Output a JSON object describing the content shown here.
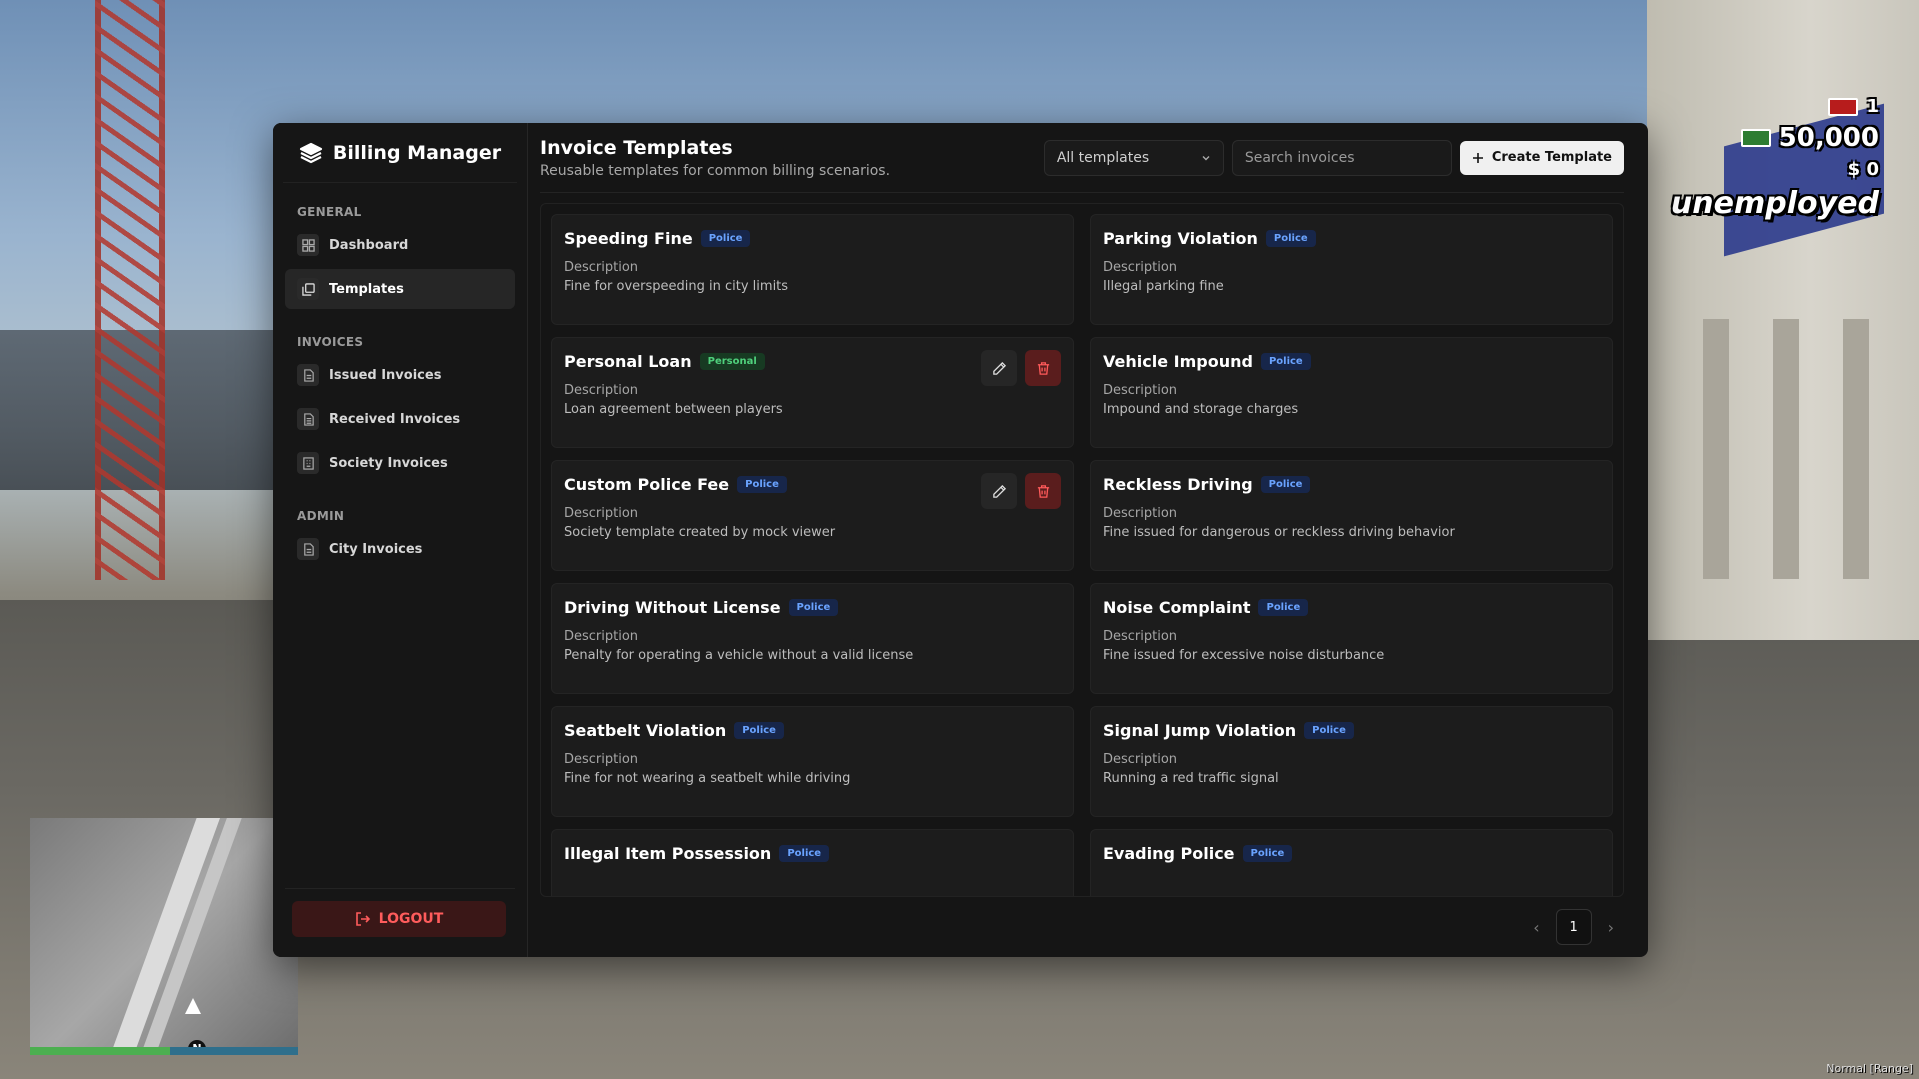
{
  "app": {
    "brand": "Billing Manager",
    "sections": {
      "general": "GENERAL",
      "invoices": "INVOICES",
      "admin": "ADMIN"
    },
    "nav": {
      "dashboard": "Dashboard",
      "templates": "Templates",
      "issued": "Issued Invoices",
      "received": "Received Invoices",
      "society": "Society Invoices",
      "city": "City Invoices"
    },
    "logout": "LOGOUT"
  },
  "header": {
    "title": "Invoice Templates",
    "subtitle": "Reusable templates for common billing scenarios.",
    "filter_value": "All templates",
    "search_placeholder": "Search invoices",
    "create_label": "Create Template"
  },
  "templates": [
    {
      "name": "Speeding Fine",
      "badge": "Police",
      "desc_label": "Description",
      "desc": "Fine for overspeeding in city limits"
    },
    {
      "name": "Parking Violation",
      "badge": "Police",
      "desc_label": "Description",
      "desc": "Illegal parking fine"
    },
    {
      "name": "Personal Loan",
      "badge": "Personal",
      "desc_label": "Description",
      "desc": "Loan agreement between players"
    },
    {
      "name": "Vehicle Impound",
      "badge": "Police",
      "desc_label": "Description",
      "desc": "Impound and storage charges"
    },
    {
      "name": "Custom Police Fee",
      "badge": "Police",
      "desc_label": "Description",
      "desc": "Society template created by mock viewer"
    },
    {
      "name": "Reckless Driving",
      "badge": "Police",
      "desc_label": "Description",
      "desc": "Fine issued for dangerous or reckless driving behavior"
    },
    {
      "name": "Driving Without License",
      "badge": "Police",
      "desc_label": "Description",
      "desc": "Penalty for operating a vehicle without a valid license"
    },
    {
      "name": "Noise Complaint",
      "badge": "Police",
      "desc_label": "Description",
      "desc": "Fine issued for excessive noise disturbance"
    },
    {
      "name": "Seatbelt Violation",
      "badge": "Police",
      "desc_label": "Description",
      "desc": "Fine for not wearing a seatbelt while driving"
    },
    {
      "name": "Signal Jump Violation",
      "badge": "Police",
      "desc_label": "Description",
      "desc": "Running a red traffic signal"
    },
    {
      "name": "Illegal Item Possession",
      "badge": "Police"
    },
    {
      "name": "Evading Police",
      "badge": "Police"
    }
  ],
  "pagination": {
    "current_page": "1"
  },
  "hud": {
    "dirty_cash": "1",
    "cash": "50,000",
    "bank": "$ 0",
    "job": "unemployed",
    "mode": "Normal [Range]",
    "north": "N"
  },
  "colors": {
    "police_badge": "#6aa3ff",
    "personal_badge": "#4fd07c",
    "logout": "#ff5c5c"
  }
}
